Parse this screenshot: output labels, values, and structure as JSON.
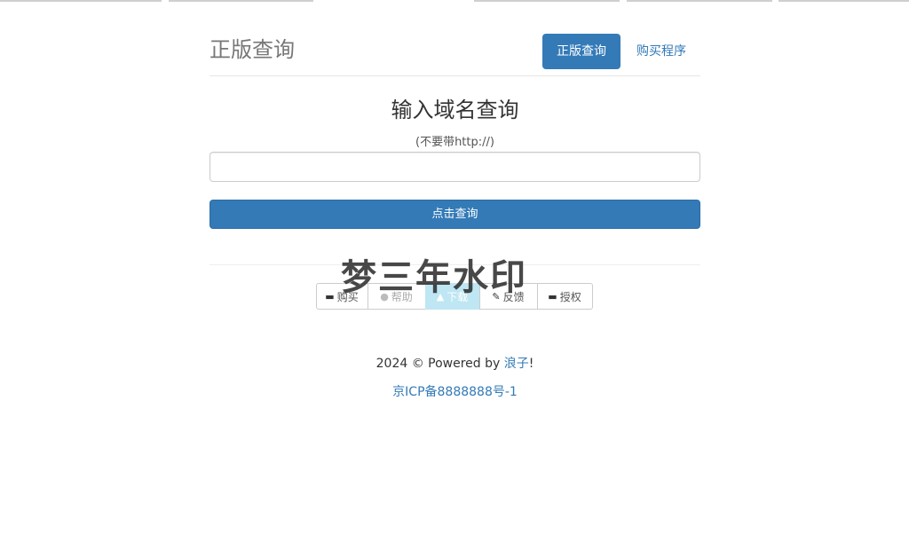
{
  "header": {
    "site_title": "正版查询",
    "nav_active": "正版查询",
    "nav_buy": "购买程序"
  },
  "query": {
    "title": "输入域名查询",
    "hint": "(不要带http://)",
    "input_value": "",
    "input_placeholder": "",
    "button_label": "点击查询"
  },
  "actions": {
    "buy": {
      "label": "购买",
      "icon": "credit-card-icon"
    },
    "help": {
      "label": "帮助",
      "icon": "info-circle-icon"
    },
    "download": {
      "label": "下载",
      "icon": "download-icon"
    },
    "feedback": {
      "label": "反馈",
      "icon": "pencil-icon"
    },
    "authorize": {
      "label": "授权",
      "icon": "card-icon"
    }
  },
  "watermark": "梦三年水印",
  "footer": {
    "prefix": "2024 © Powered by ",
    "author": "浪子",
    "suffix": "!",
    "icp": "京ICP备8888888号-1"
  },
  "colors": {
    "primary": "#337ab7",
    "info": "#bfe6f3"
  }
}
